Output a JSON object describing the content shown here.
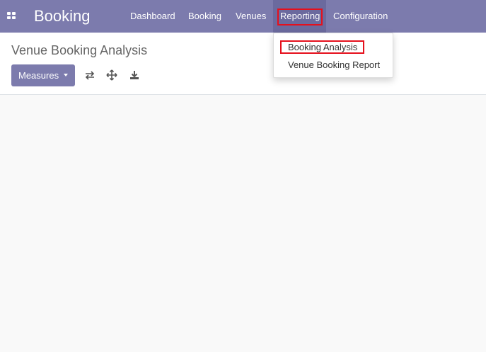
{
  "navbar": {
    "app_icon": "apps-grid-icon",
    "brand": "Booking",
    "menu": [
      {
        "label": "Dashboard"
      },
      {
        "label": "Booking"
      },
      {
        "label": "Venues"
      },
      {
        "label": "Reporting"
      },
      {
        "label": "Configuration"
      }
    ]
  },
  "reporting_dropdown": {
    "items": [
      {
        "label": "Booking Analysis"
      },
      {
        "label": "Venue Booking Report"
      }
    ]
  },
  "control_panel": {
    "title": "Venue Booking Analysis",
    "measures_label": "Measures",
    "tools": [
      "flip-axis-icon",
      "expand-all-icon",
      "download-icon"
    ]
  },
  "colors": {
    "primary": "#7c7bad",
    "highlight": "#e5101c"
  }
}
